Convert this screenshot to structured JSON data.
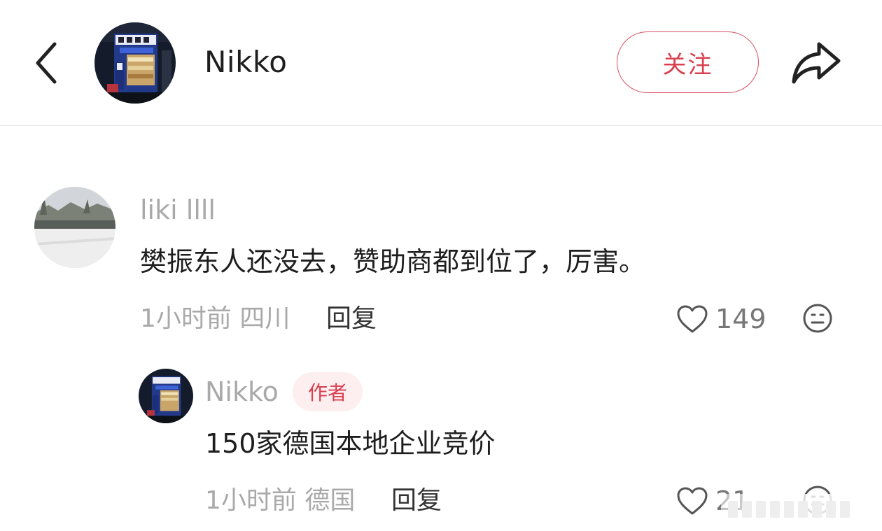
{
  "header": {
    "username": "Nikko",
    "follow_label": "关注",
    "back_icon": "chevron-left-icon",
    "share_icon": "share-arrow-icon"
  },
  "comments": [
    {
      "username": "liki llll",
      "text": "樊振东人还没去，赞助商都到位了，厉害。",
      "time": "1小时前",
      "location": "四川",
      "reply_label": "回复",
      "likes": "149"
    }
  ],
  "replies": [
    {
      "username": "Nikko",
      "badge": "作者",
      "text": "150家德国本地企业竞价",
      "time": "1小时前",
      "location": "德国",
      "reply_label": "回复",
      "likes": "21"
    }
  ],
  "colors": {
    "accent": "#d8404f",
    "badge_bg": "#fdeef0",
    "muted_text": "#a9a9a9",
    "divider": "#e9e9e9"
  }
}
